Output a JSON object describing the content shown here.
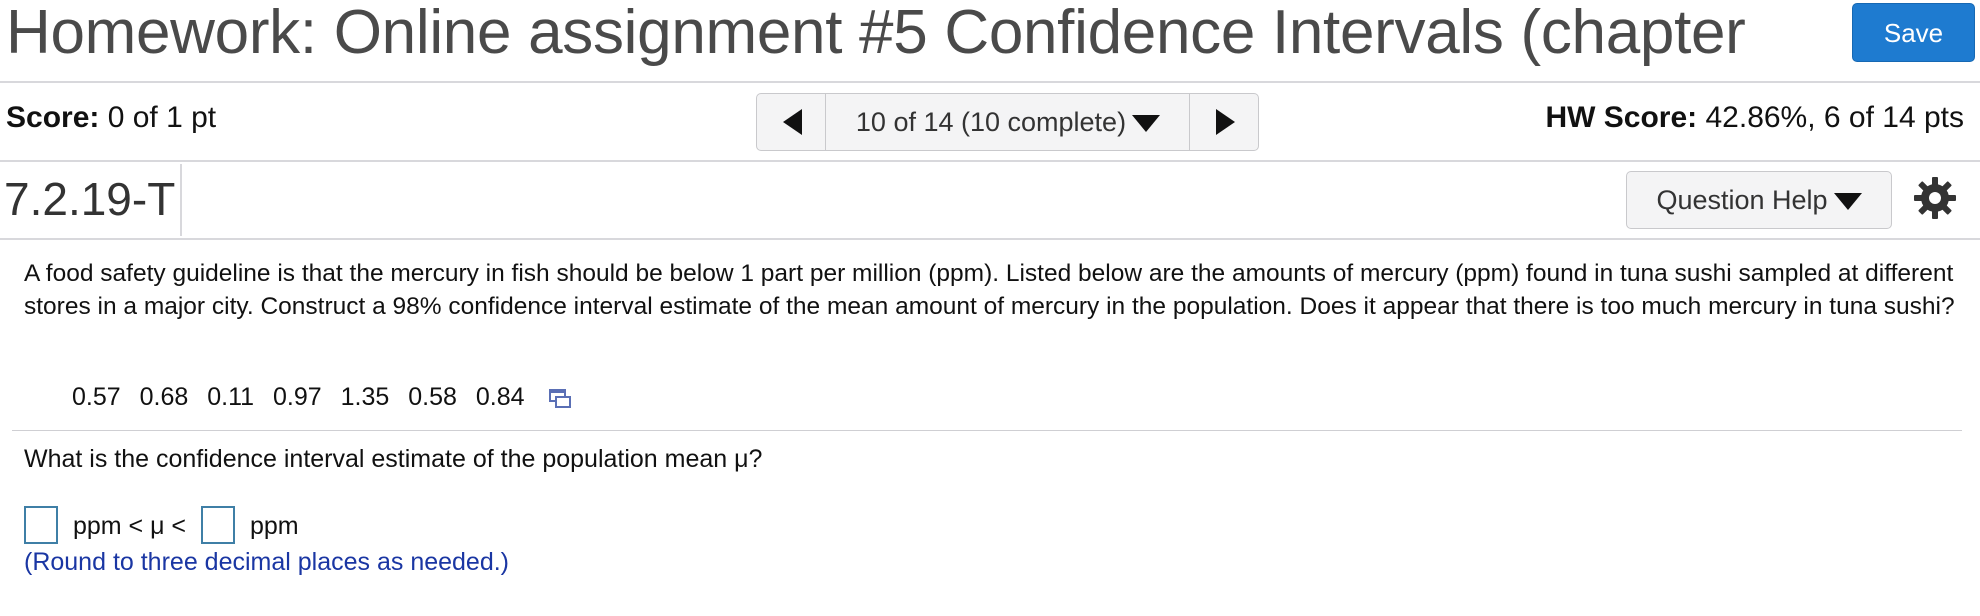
{
  "header": {
    "title": "Homework: Online assignment #5 Confidence Intervals (chapter",
    "save_label": "Save"
  },
  "score_bar": {
    "score_label": "Score:",
    "score_value": "0 of 1 pt",
    "nav_label": "10 of 14 (10 complete)",
    "hw_score_label": "HW Score:",
    "hw_score_value": "42.86%, 6 of 14 pts"
  },
  "question_bar": {
    "question_id": "7.2.19-T",
    "help_label": "Question Help"
  },
  "question": {
    "text": "A food safety guideline is that the mercury in fish should be below 1 part per million (ppm). Listed below are the amounts of mercury (ppm) found in tuna sushi sampled at different stores in a major city. Construct a 98% confidence interval estimate of the mean amount of mercury in the population. Does it appear that there is too much mercury in tuna sushi?",
    "data_values": [
      "0.57",
      "0.68",
      "0.11",
      "0.97",
      "1.35",
      "0.58",
      "0.84"
    ],
    "prompt": "What is the confidence interval estimate of the population mean μ?",
    "answer_middle": "ppm < μ <",
    "answer_unit": "ppm",
    "hint": "(Round to three decimal places as needed.)"
  },
  "colors": {
    "save_button": "#1e7bd0",
    "hint_text": "#1a36a3",
    "input_border": "#3f7fa6"
  },
  "icons": {
    "prev": "triangle-left-icon",
    "next": "triangle-right-icon",
    "dropdown": "chevron-down-icon",
    "settings": "gear-icon",
    "copy_data": "copy-data-icon"
  }
}
